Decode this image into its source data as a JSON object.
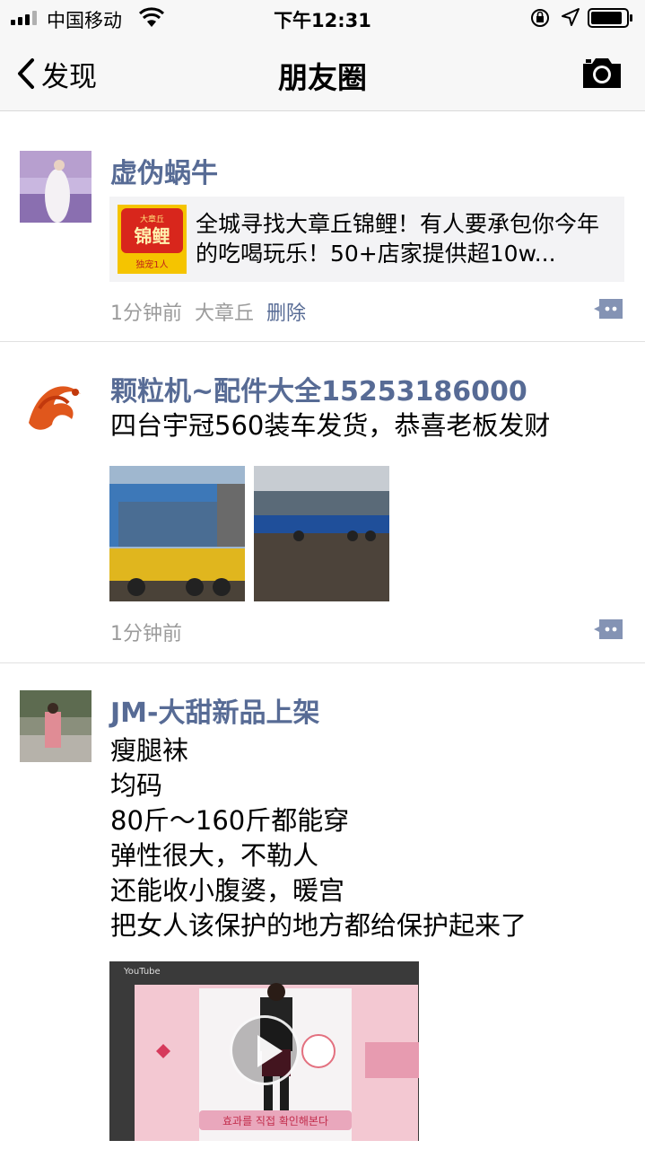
{
  "status_bar": {
    "carrier": "中国移动",
    "time": "下午12:31"
  },
  "nav": {
    "back_label": "发现",
    "title": "朋友圈"
  },
  "posts": [
    {
      "name": "虚伪蜗牛",
      "link_text": "全城寻找大章丘锦鲤！有人要承包你今年的吃喝玩乐！50+店家提供超10w...",
      "link_thumb_text": {
        "top": "大章丘",
        "main": "锦鲤",
        "bottom": "独宠1人"
      },
      "time": "1分钟前",
      "location": "大章丘",
      "delete_label": "删除"
    },
    {
      "name": "颗粒机~配件大全15253186000",
      "text": "四台宇冠560装车发货，恭喜老板发财",
      "time": "1分钟前"
    },
    {
      "name": "JM-大甜新品上架",
      "lines": [
        "瘦腿袜",
        "均码",
        "80斤～160斤都能穿",
        "弹性很大，不勒人",
        "还能收小腹婆，暖宫",
        "把女人该保护的地方都给保护起来了"
      ],
      "video_source_label": "YouTube",
      "video_caption": "효과를 직접 확인해본다"
    }
  ],
  "colors": {
    "name_link": "#576b95",
    "meta_gray": "#9b9b9b",
    "link_bg": "#f3f3f5",
    "nav_bg": "#f7f7f7"
  },
  "icons": {
    "back": "chevron-left-icon",
    "camera": "camera-icon",
    "comment": "comment-dots-icon"
  }
}
